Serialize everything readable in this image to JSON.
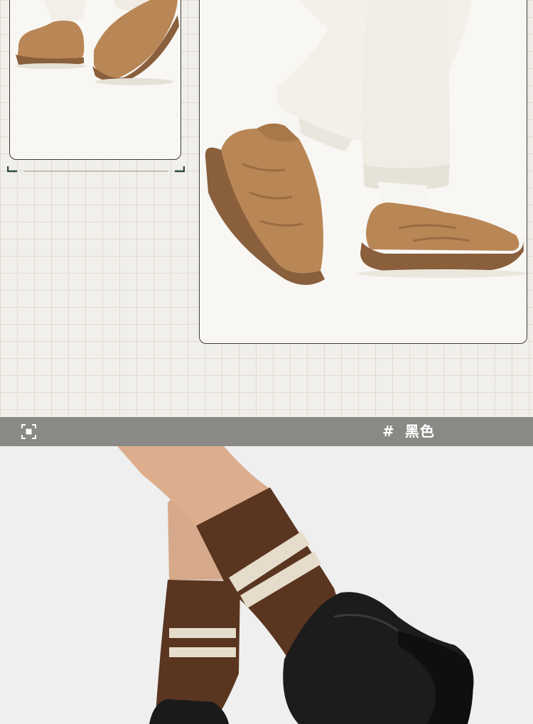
{
  "color_bar": {
    "hash": "#",
    "color_name": "黑色"
  },
  "icons": {
    "focus": "focus-frame-icon"
  },
  "colors": {
    "background": "#f1efea",
    "bar": "#8a8985",
    "camel": "#b98655",
    "sole_brown": "#8a5f3c",
    "black_shoe": "#1c1c1c",
    "sock_brown": "#5a3520",
    "sock_stripe": "#e6dccb"
  }
}
